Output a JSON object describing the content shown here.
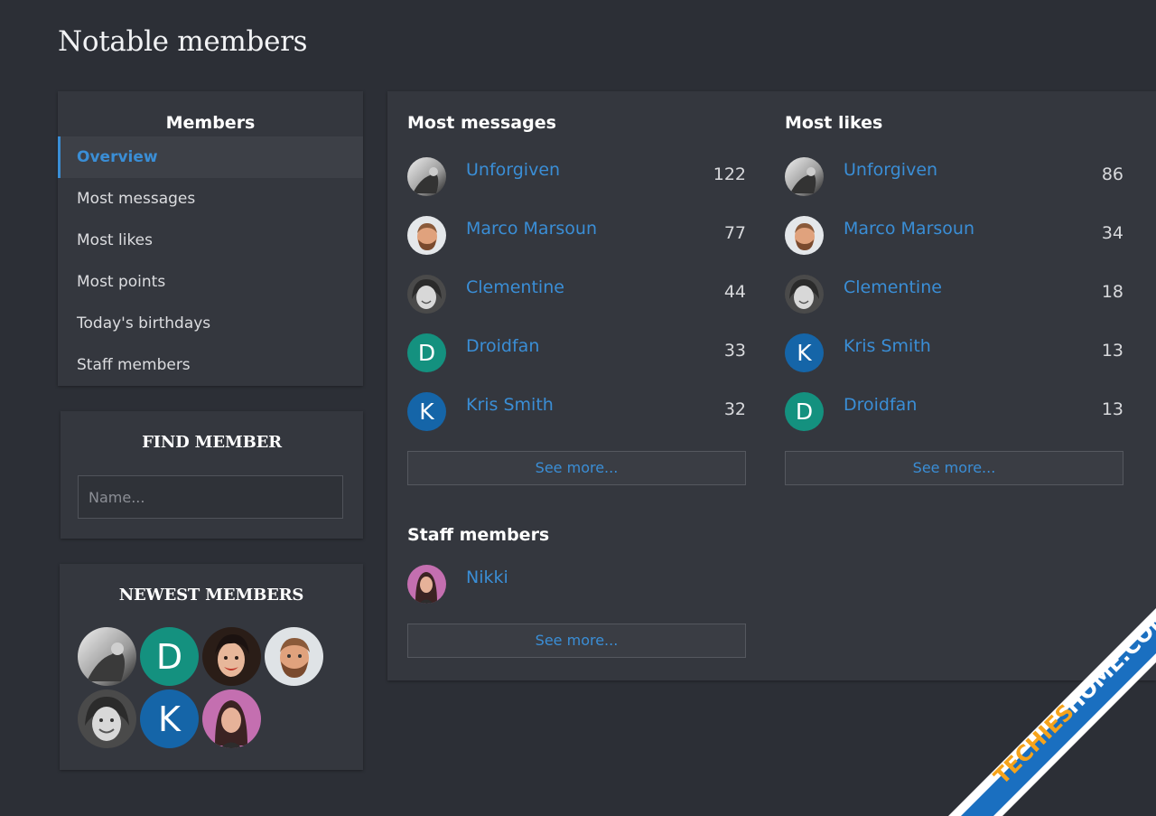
{
  "page": {
    "title": "Notable members"
  },
  "sidebar": {
    "members_heading": "Members",
    "nav": [
      {
        "label": "Overview",
        "active": true
      },
      {
        "label": "Most messages",
        "active": false
      },
      {
        "label": "Most likes",
        "active": false
      },
      {
        "label": "Most points",
        "active": false
      },
      {
        "label": "Today's birthdays",
        "active": false
      },
      {
        "label": "Staff members",
        "active": false
      }
    ],
    "find": {
      "heading": "FIND MEMBER",
      "placeholder": "Name..."
    },
    "newest": {
      "heading": "NEWEST MEMBERS",
      "avatars": [
        {
          "kind": "photo",
          "icon": "avatar-photo-grayscale"
        },
        {
          "kind": "letter",
          "letter": "D",
          "color": "#14917f"
        },
        {
          "kind": "photo",
          "icon": "avatar-photo-woman-dark-hair"
        },
        {
          "kind": "photo",
          "icon": "avatar-photo-man-beard"
        },
        {
          "kind": "photo",
          "icon": "avatar-photo-woman-smiling"
        },
        {
          "kind": "letter",
          "letter": "K",
          "color": "#1565a8"
        },
        {
          "kind": "photo",
          "icon": "avatar-illustration-woman"
        }
      ]
    }
  },
  "main": {
    "most_messages": {
      "title": "Most messages",
      "rows": [
        {
          "name": "Unforgiven",
          "count": "122",
          "avatar": "photo-bw"
        },
        {
          "name": "Marco Marsoun",
          "count": "77",
          "avatar": "photo-man"
        },
        {
          "name": "Clementine",
          "count": "44",
          "avatar": "photo-woman"
        },
        {
          "name": "Droidfan",
          "count": "33",
          "avatar": "letter",
          "letter": "D"
        },
        {
          "name": "Kris Smith",
          "count": "32",
          "avatar": "letter",
          "letter": "K"
        }
      ],
      "see_more": "See more..."
    },
    "most_likes": {
      "title": "Most likes",
      "rows": [
        {
          "name": "Unforgiven",
          "count": "86",
          "avatar": "photo-bw"
        },
        {
          "name": "Marco Marsoun",
          "count": "34",
          "avatar": "photo-man"
        },
        {
          "name": "Clementine",
          "count": "18",
          "avatar": "photo-woman"
        },
        {
          "name": "Kris Smith",
          "count": "13",
          "avatar": "letter",
          "letter": "K"
        },
        {
          "name": "Droidfan",
          "count": "13",
          "avatar": "letter",
          "letter": "D"
        }
      ],
      "see_more": "See more..."
    },
    "staff": {
      "title": "Staff members",
      "rows": [
        {
          "name": "Nikki",
          "avatar": "illustration"
        }
      ],
      "see_more": "See more..."
    }
  },
  "colors": {
    "background": "#2c2f36",
    "panel": "#34373e",
    "link": "#3a8ed6",
    "teal_avatar": "#14917f",
    "blue_avatar": "#1565a8",
    "watermark_blue": "#1a6fc0",
    "watermark_orange": "#f6a31b"
  },
  "watermark": {
    "text_part1": "TECHIES",
    "text_part2": "HOME.COM"
  }
}
